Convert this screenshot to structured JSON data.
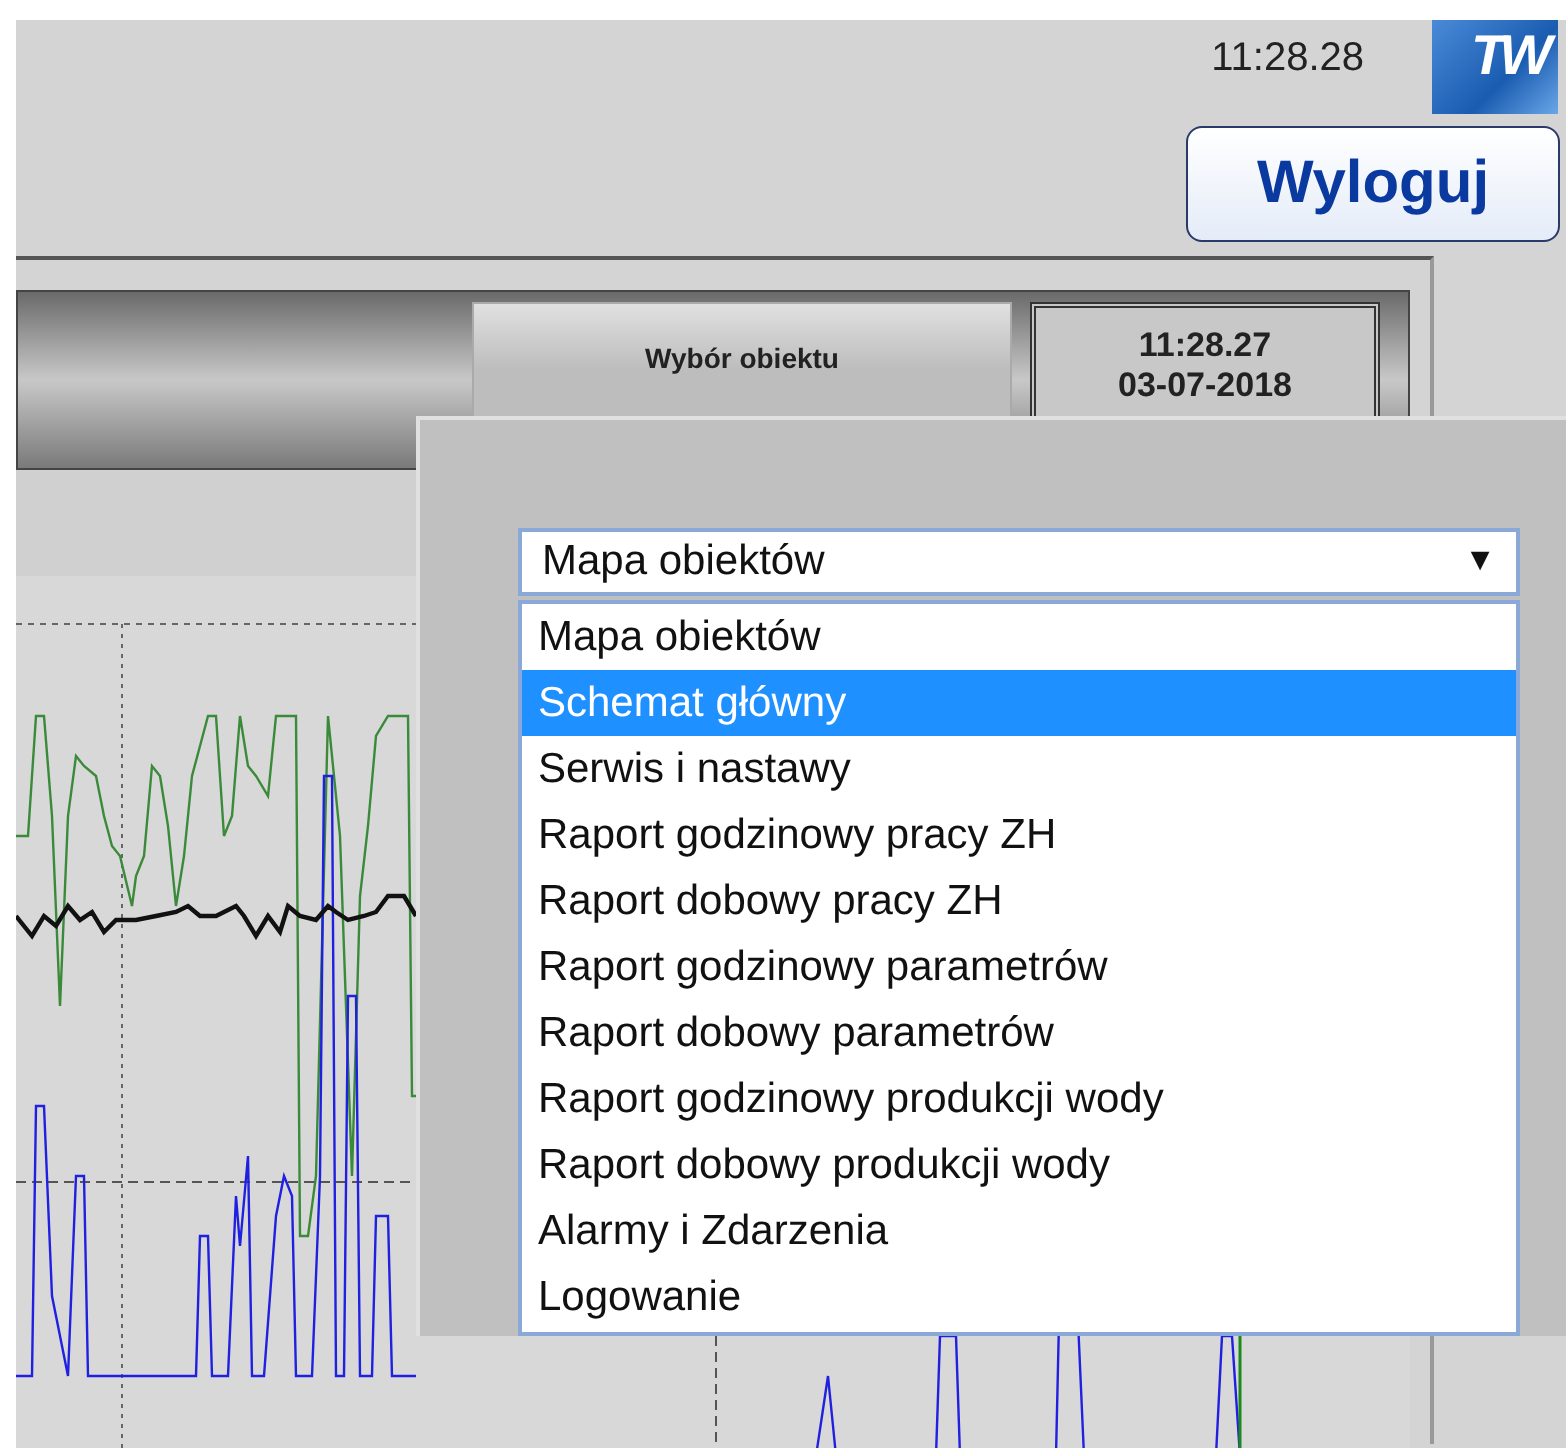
{
  "header": {
    "time": "11:28.28",
    "logo_text": "TW",
    "logout_button": "Wyloguj"
  },
  "toolbar": {
    "object_button": "Wybór obiektu",
    "clock_time": "11:28.27",
    "clock_date": "03-07-2018"
  },
  "dialog": {
    "select": {
      "value": "Mapa obiektów",
      "arrow": "▼"
    },
    "options": [
      {
        "label": "Mapa obiektów",
        "selected": false
      },
      {
        "label": "Schemat główny",
        "selected": true
      },
      {
        "label": "Serwis i nastawy",
        "selected": false
      },
      {
        "label": "Raport godzinowy pracy ZH",
        "selected": false
      },
      {
        "label": "Raport dobowy pracy ZH",
        "selected": false
      },
      {
        "label": "Raport godzinowy parametrów",
        "selected": false
      },
      {
        "label": "Raport dobowy parametrów",
        "selected": false
      },
      {
        "label": "Raport godzinowy produkcji wody",
        "selected": false
      },
      {
        "label": "Raport dobowy produkcji wody",
        "selected": false
      },
      {
        "label": "Alarmy i Zdarzenia",
        "selected": false
      },
      {
        "label": "Logowanie",
        "selected": false
      }
    ]
  }
}
